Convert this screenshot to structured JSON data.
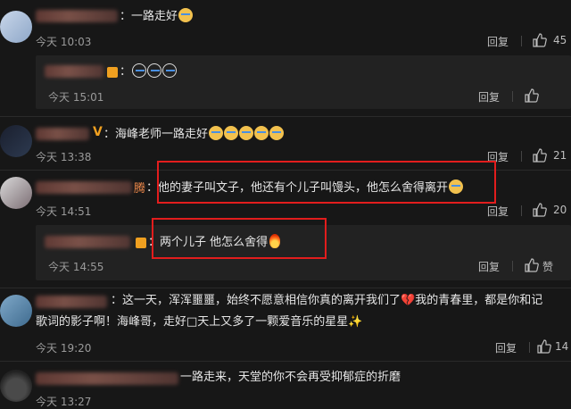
{
  "comments": [
    {
      "text": "：一路走好",
      "emoji_count": 1,
      "time": "今天 10:03",
      "reply": "回复",
      "likes": "45"
    },
    {
      "text": "：",
      "emoji_count": 3,
      "time": "今天 15:01",
      "reply": "回复",
      "likes": ""
    },
    {
      "text": "：海峰老师一路走好",
      "emoji_count": 5,
      "time": "今天 13:38",
      "reply": "回复",
      "likes": "21"
    },
    {
      "name_tail": "腾",
      "text": "：他的妻子叫文子，他还有个儿子叫馒头，他怎么舍得离开",
      "emoji_count": 1,
      "time": "今天 14:51",
      "reply": "回复",
      "likes": "20"
    },
    {
      "text": "：两个儿子 他怎么舍得",
      "time": "今天 14:55",
      "reply": "回复",
      "likes": "赞"
    },
    {
      "text_line1": "：这一天，浑浑噩噩，始终不愿意相信你真的离开我们了",
      "heart": "💔",
      "text_line1b": "我的青春里，都是你和记",
      "text_line2": "歌词的影子啊！海峰哥，走好□天上又多了一颗爱音乐的星星",
      "sparkle": "✨",
      "time": "今天 19:20",
      "reply": "回复",
      "likes": "14"
    },
    {
      "text": "一路走来，天堂的你不会再受抑郁症的折磨",
      "time": "今天 13:27"
    }
  ],
  "icons": {
    "like": "thumbs-up-icon",
    "verified": "verified-badge-icon"
  }
}
